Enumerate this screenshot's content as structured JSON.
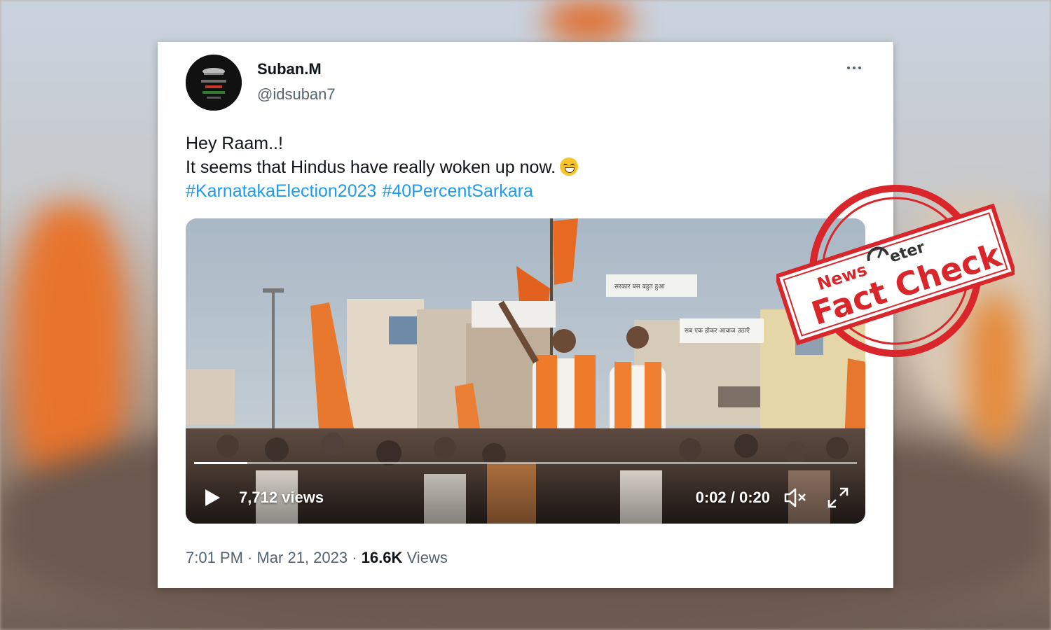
{
  "tweet": {
    "display_name": "Suban.M",
    "handle": "@idsuban7",
    "text_line1": "Hey Raam..!",
    "text_line2": "It seems that Hindus have really woken up now.",
    "hashtags": [
      "#KarnatakaElection2023",
      "#40PercentSarkara"
    ],
    "timestamp": "7:01 PM · Mar 21, 2023",
    "separator": " · ",
    "view_count": "16.6K",
    "views_label": "Views"
  },
  "video": {
    "views": "7,712 views",
    "time": "0:02 / 0:20",
    "progress": 0.08,
    "signs": [
      "सरकार बस बहुत हुआ",
      "सब एक होकर आवाज उठाएँ"
    ]
  },
  "stamp": {
    "brand_left": "News",
    "brand_right": "eter",
    "label": "Fact Check",
    "color": "#d8262b"
  },
  "colors": {
    "link": "#1d9bf0",
    "text": "#0f1419",
    "muted": "#536471"
  }
}
